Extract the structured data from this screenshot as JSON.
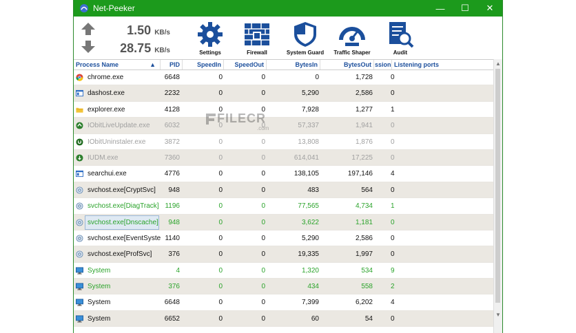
{
  "window": {
    "title": "Net-Peeker"
  },
  "controls": {
    "minimize": "—",
    "maximize": "☐",
    "close": "✕"
  },
  "speeds": {
    "in_value": "1.50",
    "in_unit": "KB/s",
    "out_value": "28.75",
    "out_unit": "KB/s"
  },
  "toolbar": {
    "settings": "Settings",
    "firewall": "Firewall",
    "guard": "System Guard",
    "shaper": "Traffic Shaper",
    "audit": "Audit"
  },
  "table": {
    "headers": {
      "name": "Process Name",
      "pid": "PID",
      "speed_in": "SpeedIn",
      "speed_out": "SpeedOut",
      "bytes_in": "BytesIn",
      "bytes_out": "BytesOut",
      "sessions": "ssions",
      "ports": "Listening ports"
    },
    "rows": [
      {
        "name": "chrome.exe",
        "pid": "6648",
        "in": "0",
        "out": "0",
        "bin": "0",
        "bout": "1,728",
        "sess": "0"
      },
      {
        "name": "dashost.exe",
        "pid": "2232",
        "in": "0",
        "out": "0",
        "bin": "5,290",
        "bout": "2,586",
        "sess": "0"
      },
      {
        "name": "explorer.exe",
        "pid": "4128",
        "in": "0",
        "out": "0",
        "bin": "7,928",
        "bout": "1,277",
        "sess": "1"
      },
      {
        "name": "IObitLiveUpdate.exe",
        "pid": "6032",
        "in": "0",
        "out": "0",
        "bin": "57,337",
        "bout": "1,941",
        "sess": "0"
      },
      {
        "name": "IObitUninstaler.exe",
        "pid": "3872",
        "in": "0",
        "out": "0",
        "bin": "13,808",
        "bout": "1,876",
        "sess": "0"
      },
      {
        "name": "IUDM.exe",
        "pid": "7360",
        "in": "0",
        "out": "0",
        "bin": "614,041",
        "bout": "17,225",
        "sess": "0"
      },
      {
        "name": "searchui.exe",
        "pid": "4776",
        "in": "0",
        "out": "0",
        "bin": "138,105",
        "bout": "197,146",
        "sess": "4"
      },
      {
        "name": "svchost.exe[CryptSvc]",
        "pid": "948",
        "in": "0",
        "out": "0",
        "bin": "483",
        "bout": "564",
        "sess": "0"
      },
      {
        "name": "svchost.exe[DiagTrack]",
        "pid": "1196",
        "in": "0",
        "out": "0",
        "bin": "77,565",
        "bout": "4,734",
        "sess": "1"
      },
      {
        "name": "svchost.exe[Dnscache]",
        "pid": "948",
        "in": "0",
        "out": "0",
        "bin": "3,622",
        "bout": "1,181",
        "sess": "0"
      },
      {
        "name": "svchost.exe[EventSyste...",
        "pid": "1140",
        "in": "0",
        "out": "0",
        "bin": "5,290",
        "bout": "2,586",
        "sess": "0"
      },
      {
        "name": "svchost.exe[ProfSvc]",
        "pid": "376",
        "in": "0",
        "out": "0",
        "bin": "19,335",
        "bout": "1,997",
        "sess": "0"
      },
      {
        "name": "System",
        "pid": "4",
        "in": "0",
        "out": "0",
        "bin": "1,320",
        "bout": "534",
        "sess": "9"
      },
      {
        "name": "System",
        "pid": "376",
        "in": "0",
        "out": "0",
        "bin": "434",
        "bout": "558",
        "sess": "2"
      },
      {
        "name": "System",
        "pid": "6648",
        "in": "0",
        "out": "0",
        "bin": "7,399",
        "bout": "6,202",
        "sess": "4"
      },
      {
        "name": "System",
        "pid": "6652",
        "in": "0",
        "out": "0",
        "bin": "60",
        "bout": "54",
        "sess": "0"
      }
    ]
  },
  "watermark": {
    "text": "FILECR",
    "sub": ".com"
  }
}
